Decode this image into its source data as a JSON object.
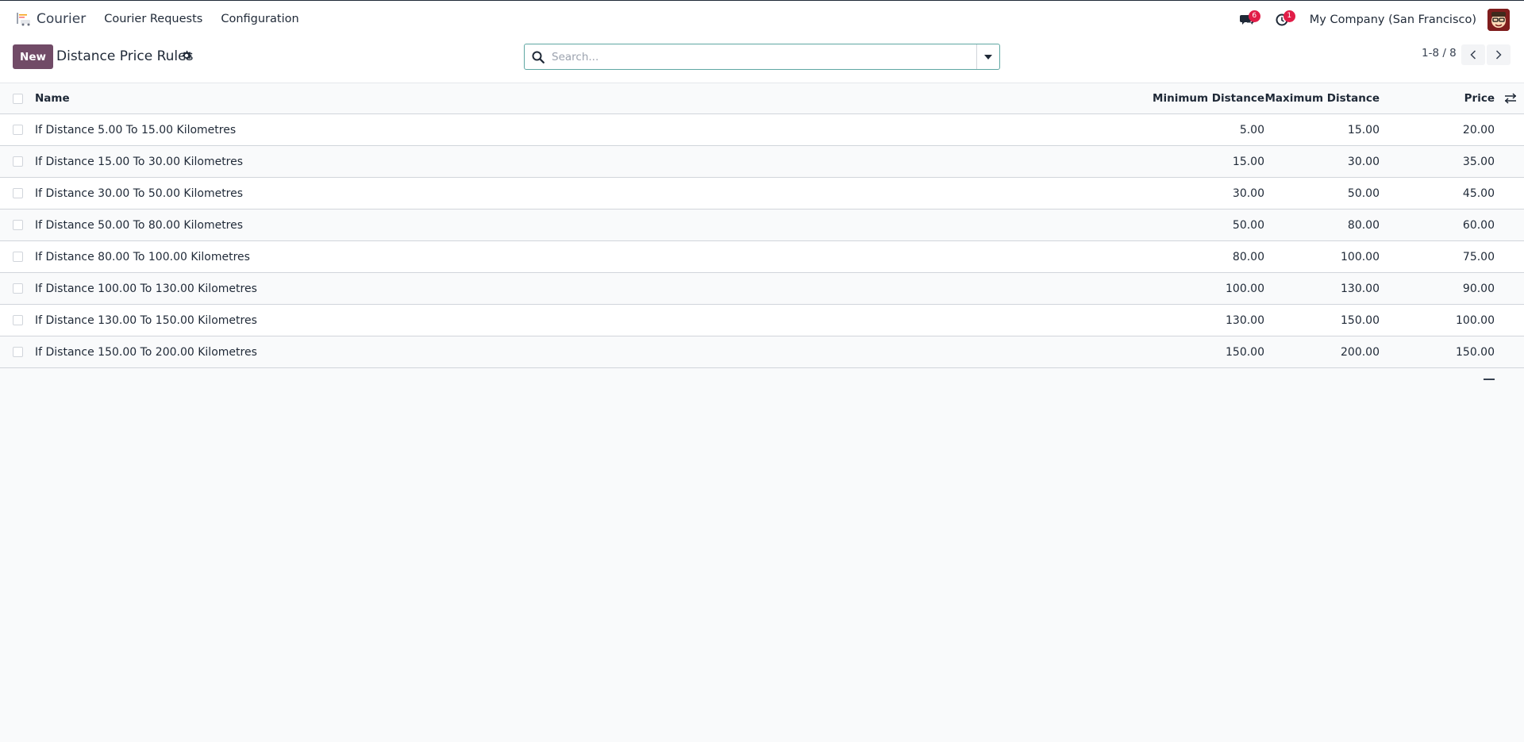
{
  "navbar": {
    "app_name": "Courier",
    "menu": [
      {
        "label": "Courier Requests"
      },
      {
        "label": "Configuration"
      }
    ],
    "messages_count": "6",
    "activities_count": "1",
    "company": "My Company (San Francisco)"
  },
  "control_panel": {
    "new_label": "New",
    "title": "Distance Price Rules",
    "search_placeholder": "Search...",
    "pager": "1-8 / 8"
  },
  "table": {
    "headers": {
      "name": "Name",
      "min": "Minimum Distance",
      "max": "Maximum Distance",
      "price": "Price"
    },
    "rows": [
      {
        "name": "If Distance 5.00 To 15.00 Kilometres",
        "min": "5.00",
        "max": "15.00",
        "price": "20.00"
      },
      {
        "name": "If Distance 15.00 To 30.00 Kilometres",
        "min": "15.00",
        "max": "30.00",
        "price": "35.00"
      },
      {
        "name": "If Distance 30.00 To 50.00 Kilometres",
        "min": "30.00",
        "max": "50.00",
        "price": "45.00"
      },
      {
        "name": "If Distance 50.00 To 80.00 Kilometres",
        "min": "50.00",
        "max": "80.00",
        "price": "60.00"
      },
      {
        "name": "If Distance 80.00 To 100.00 Kilometres",
        "min": "80.00",
        "max": "100.00",
        "price": "75.00"
      },
      {
        "name": "If Distance 100.00 To 130.00 Kilometres",
        "min": "100.00",
        "max": "130.00",
        "price": "90.00"
      },
      {
        "name": "If Distance 130.00 To 150.00 Kilometres",
        "min": "130.00",
        "max": "150.00",
        "price": "100.00"
      },
      {
        "name": "If Distance 150.00 To 200.00 Kilometres",
        "min": "150.00",
        "max": "200.00",
        "price": "150.00"
      }
    ]
  },
  "colors": {
    "primary": "#714b67",
    "badge": "#e11d48",
    "search_border": "#5fa7a3"
  }
}
